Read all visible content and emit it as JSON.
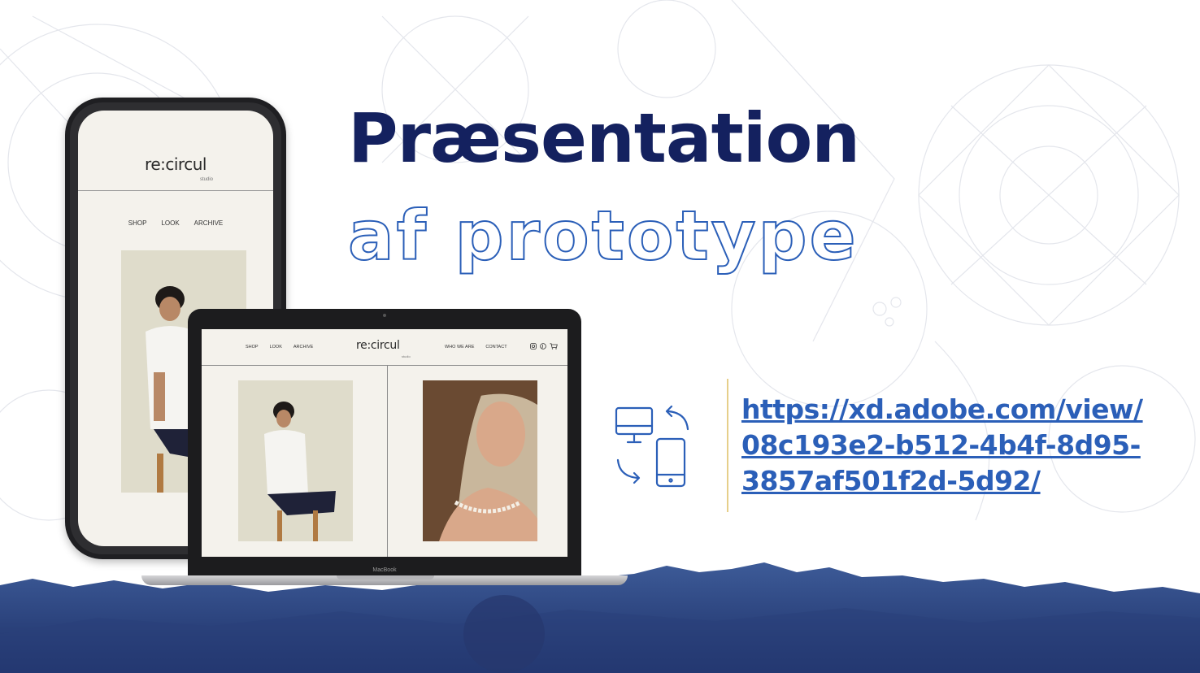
{
  "slide": {
    "title_line1": "Præsentation",
    "title_line2": "af prototype",
    "link_lines": [
      "https://xd.adobe.com/view/",
      "08c193e2-b512-4b4f-8d95-",
      "3857af501f2d-5d92/"
    ],
    "accent_color": "#14215f",
    "link_color": "#2b5fb8"
  },
  "phone": {
    "brand": "re:circul",
    "sub": "studio",
    "nav": [
      "SHOP",
      "LOOK",
      "ARCHIVE"
    ]
  },
  "laptop": {
    "brand": "re:circul",
    "sub": "studio",
    "nav_left": [
      "SHOP",
      "LOOK",
      "ARCHIVE"
    ],
    "nav_right": [
      "WHO WE ARE",
      "CONTACT"
    ],
    "chin_label": "MacBook",
    "icons": [
      "instagram-icon",
      "pinterest-icon",
      "cart-icon"
    ]
  }
}
